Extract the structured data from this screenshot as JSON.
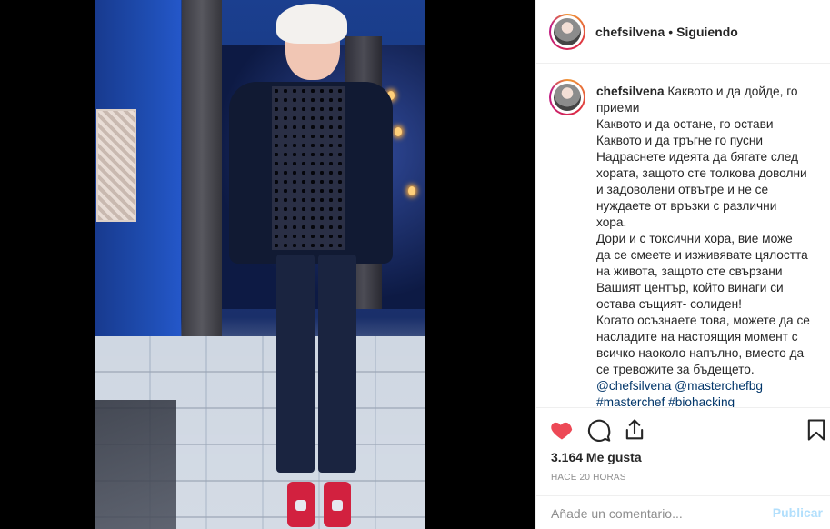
{
  "post": {
    "username": "chefsilvena",
    "separator": "•",
    "follow_status": "Siguiendo",
    "caption_lines": [
      "Каквото и да дойде, го",
      "приеми",
      "Каквото и да остане, го остави",
      "Каквото и да тръгне го пусни",
      "Надраснете идеята да бягате след",
      "хората, защото сте толкова доволни",
      "и задоволени отвътре и не се",
      "нуждаете от връзки с различни",
      "хора.",
      "Дори и с токсични хора, вие може",
      "да се смеете и изживявате цялостта",
      "на живота, защото сте свързани",
      "Вашият център, който винаги си",
      "остава същият- солиден!",
      "Когато осъзнаете това, можете да се",
      "насладите на настоящия момент с",
      "всичко наоколо напълно, вместо да",
      "се тревожите за бъдещето."
    ],
    "mentions": "@chefsilvena @masterchefbg",
    "hashtags": "#masterchef #biohacking",
    "likes": "3.164 Me gusta",
    "timestamp": "HACE 20 HORAS",
    "comment_placeholder": "Añade un comentario...",
    "publish_label": "Publicar"
  },
  "icons": {
    "like": "heart-icon",
    "comment": "comment-icon",
    "share": "share-icon",
    "save": "bookmark-icon"
  },
  "colors": {
    "like": "#ed4956",
    "link": "#003569",
    "publish_disabled": "#b2dffc",
    "muted": "#8e8e8e"
  }
}
